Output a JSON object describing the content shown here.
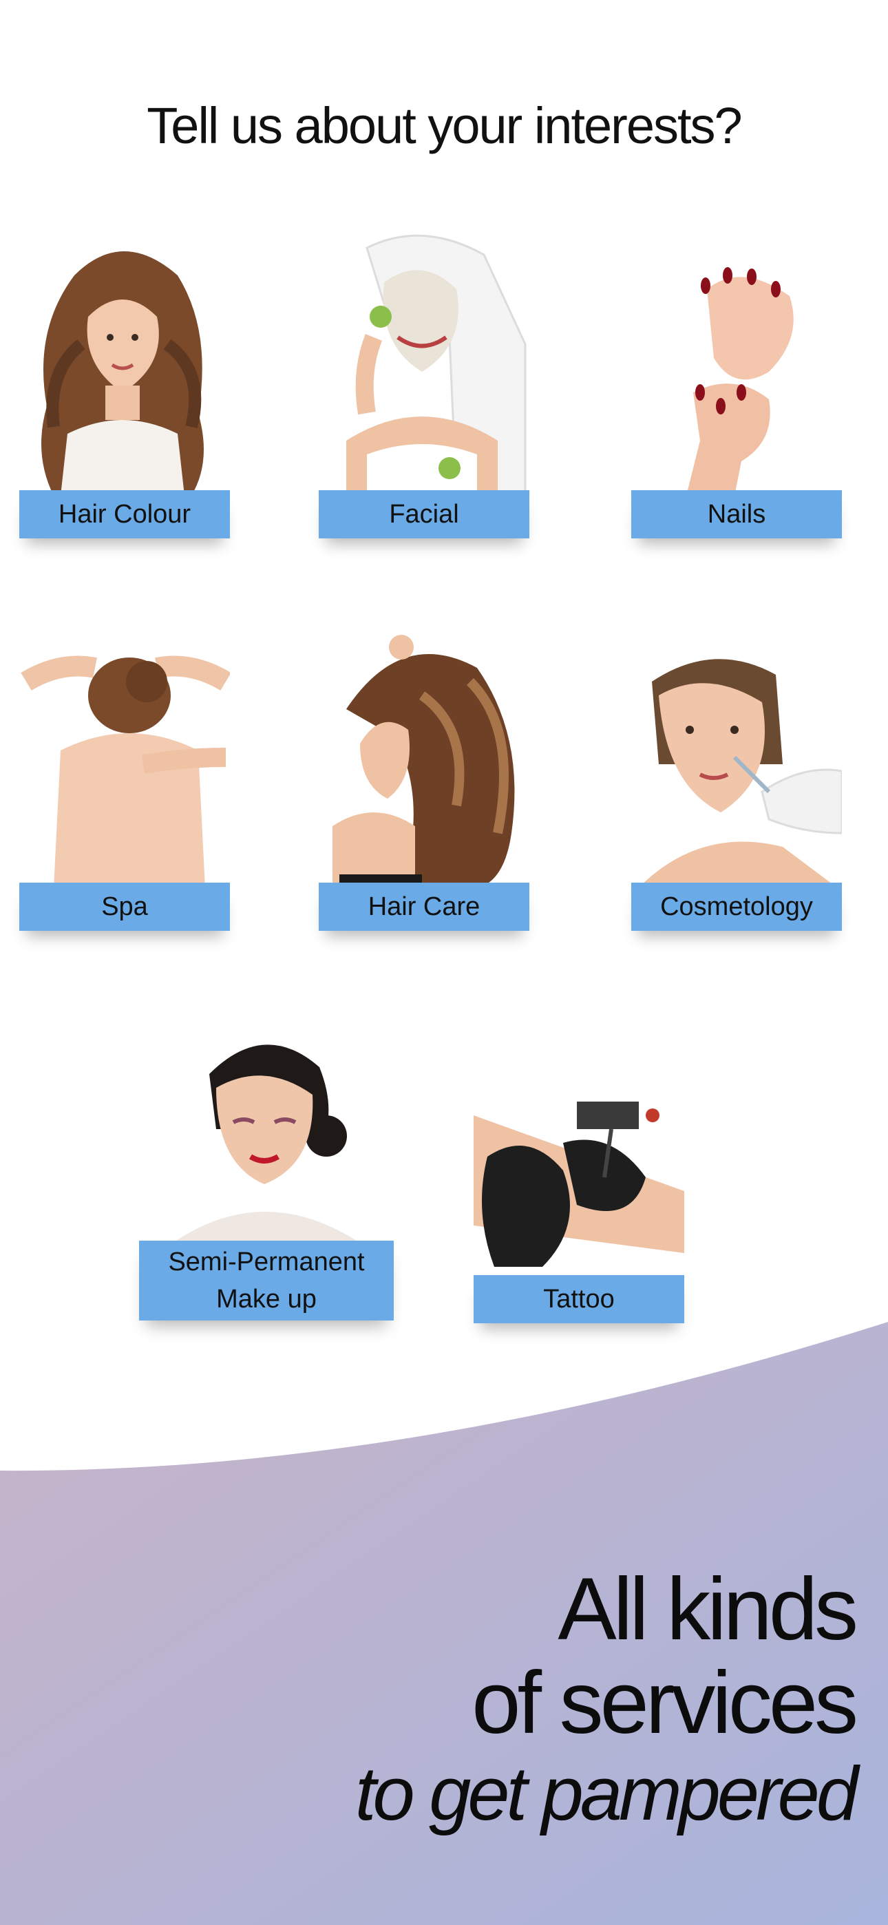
{
  "header": {
    "title": "Tell us about your interests?"
  },
  "interests": [
    {
      "id": "hair-colour",
      "label": "Hair Colour",
      "icon": "hair-colour-photo"
    },
    {
      "id": "facial",
      "label": "Facial",
      "icon": "facial-photo"
    },
    {
      "id": "nails",
      "label": "Nails",
      "icon": "nails-photo"
    },
    {
      "id": "spa",
      "label": "Spa",
      "icon": "spa-photo"
    },
    {
      "id": "hair-care",
      "label": "Hair Care",
      "icon": "hair-care-photo"
    },
    {
      "id": "cosmetology",
      "label": "Cosmetology",
      "icon": "cosmetology-photo"
    },
    {
      "id": "semi-permanent",
      "label_line1": "Semi-Permanent",
      "label_line2": "Make up",
      "icon": "makeup-photo"
    },
    {
      "id": "tattoo",
      "label": "Tattoo",
      "icon": "tattoo-photo"
    }
  ],
  "promo": {
    "line1": "All kinds",
    "line2": "of services",
    "line3": "to get pampered"
  },
  "colors": {
    "label_bg": "#6aaae6",
    "wave_start": "#c8b4c8",
    "wave_end": "#a8b4dc"
  }
}
